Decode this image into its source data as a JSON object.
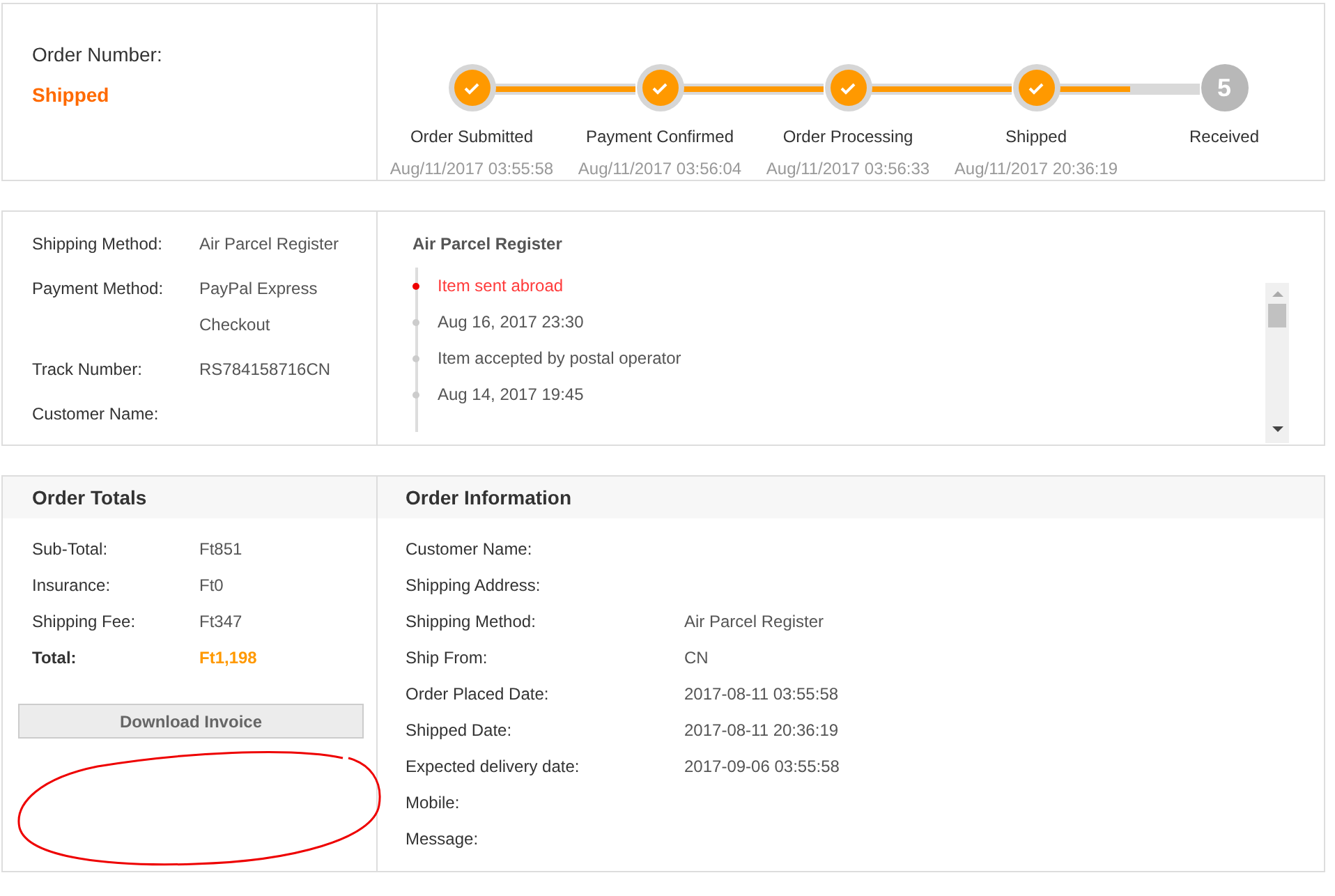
{
  "order": {
    "number_label": "Order Number:",
    "status": "Shipped"
  },
  "progress": {
    "connectors": [
      {
        "level": 1
      },
      {
        "level": 1
      },
      {
        "level": 1
      },
      {
        "level": 0.5
      }
    ],
    "steps": [
      {
        "label": "Order Submitted",
        "date": "Aug/11/2017 03:55:58",
        "completed": true
      },
      {
        "label": "Payment Confirmed",
        "date": "Aug/11/2017 03:56:04",
        "completed": true
      },
      {
        "label": "Order Processing",
        "date": "Aug/11/2017 03:56:33",
        "completed": true
      },
      {
        "label": "Shipped",
        "date": "Aug/11/2017 20:36:19",
        "completed": true
      },
      {
        "label": "Received",
        "completed": false,
        "number": "5"
      }
    ]
  },
  "shipping_info": [
    {
      "label": "Shipping Method:",
      "value": "Air Parcel Register"
    },
    {
      "label": "Payment Method:",
      "value": "PayPal Express Checkout"
    },
    {
      "label": "Track Number:",
      "value": "RS784158716CN"
    },
    {
      "label": "Customer Name:"
    }
  ],
  "tracking": {
    "title": "Air Parcel Register",
    "items": [
      {
        "text": "Item sent abroad",
        "current": true
      },
      {
        "text": "Aug 16, 2017 23:30",
        "current": false
      },
      {
        "text": "Item accepted by postal operator",
        "current": false
      },
      {
        "text": "Aug 14, 2017 19:45",
        "current": false
      }
    ]
  },
  "order_totals": {
    "title": "Order Totals",
    "rows": [
      {
        "label": "Sub-Total:",
        "value": "Ft851",
        "emphasis": false
      },
      {
        "label": "Insurance:",
        "value": "Ft0",
        "emphasis": false
      },
      {
        "label": "Shipping Fee:",
        "value": "Ft347",
        "emphasis": false
      },
      {
        "label": "Total:",
        "value": "Ft1,198",
        "emphasis": true
      }
    ],
    "button": "Download Invoice"
  },
  "order_information": {
    "title": "Order Information",
    "rows": [
      {
        "label": "Customer Name:"
      },
      {
        "label": "Shipping Address:"
      },
      {
        "label": "Shipping Method:",
        "value": "Air Parcel Register"
      },
      {
        "label": "Ship From:",
        "value": "CN"
      },
      {
        "label": "Order Placed Date:",
        "value": "2017-08-11 03:55:58"
      },
      {
        "label": "Shipped Date:",
        "value": "2017-08-11 20:36:19"
      },
      {
        "label": "Expected delivery date:",
        "value": "2017-09-06 03:55:58"
      },
      {
        "label": "Mobile:"
      },
      {
        "label": "Message:"
      }
    ]
  }
}
